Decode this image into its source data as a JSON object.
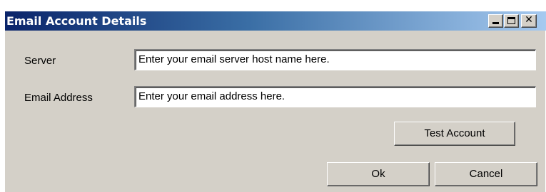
{
  "window": {
    "title": "Email Account Details",
    "controls": {
      "minimize": "_",
      "maximize": "□",
      "close": "✕"
    }
  },
  "form": {
    "server_label": "Server",
    "server_value": "Enter your email server host name here.",
    "email_label": "Email Address",
    "email_value": "Enter your email address here."
  },
  "buttons": {
    "test_account": "Test Account",
    "ok": "Ok",
    "cancel": "Cancel"
  },
  "colors": {
    "titlebar_start": "#0a246a",
    "titlebar_end": "#a6caf0",
    "face": "#d4d0c8"
  }
}
